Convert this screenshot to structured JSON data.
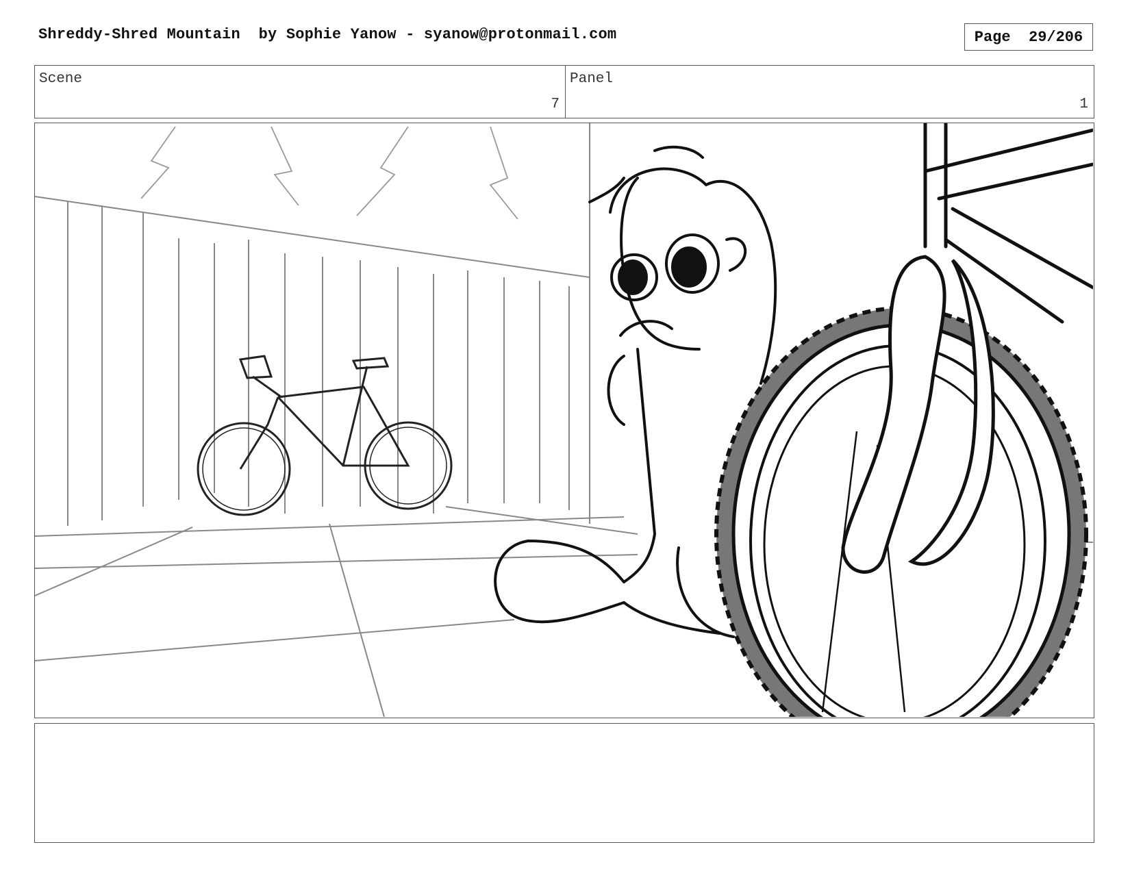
{
  "header": {
    "title": "Shreddy-Shred Mountain  by Sophie Yanow - syanow@protonmail.com",
    "page_label": "Page  29/206"
  },
  "scene": {
    "label": "Scene",
    "value": "7"
  },
  "panel": {
    "label": "Panel",
    "value": "1"
  },
  "notes": {
    "text": ""
  }
}
